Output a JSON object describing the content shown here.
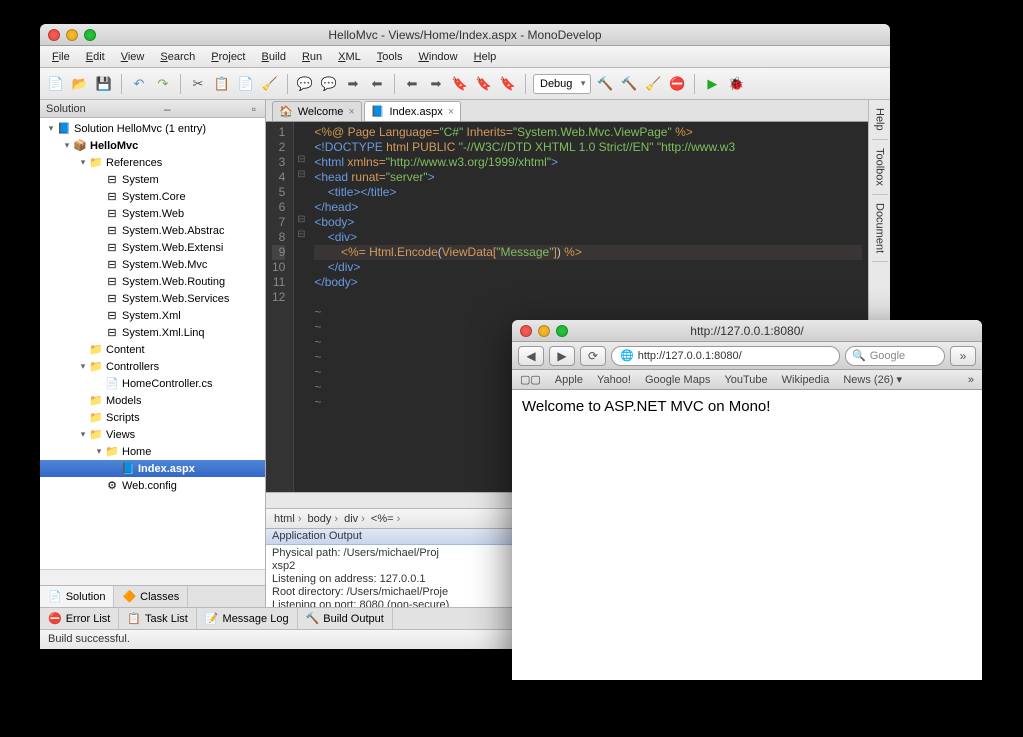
{
  "ide": {
    "title": "HelloMvc - Views/Home/Index.aspx - MonoDevelop",
    "menus": [
      "File",
      "Edit",
      "View",
      "Search",
      "Project",
      "Build",
      "Run",
      "XML",
      "Tools",
      "Window",
      "Help"
    ],
    "config": "Debug",
    "solution_panel": {
      "title": "Solution",
      "tabs": [
        {
          "icon": "📄",
          "label": "Solution"
        },
        {
          "icon": "🔶",
          "label": "Classes"
        }
      ],
      "tree": [
        {
          "depth": 0,
          "tw": "▾",
          "icon": "📘",
          "label": "Solution HelloMvc (1 entry)"
        },
        {
          "depth": 1,
          "tw": "▾",
          "icon": "📦",
          "label": "HelloMvc",
          "bold": true
        },
        {
          "depth": 2,
          "tw": "▾",
          "icon": "📁",
          "label": "References"
        },
        {
          "depth": 3,
          "tw": "",
          "icon": "⊟",
          "label": "System"
        },
        {
          "depth": 3,
          "tw": "",
          "icon": "⊟",
          "label": "System.Core"
        },
        {
          "depth": 3,
          "tw": "",
          "icon": "⊟",
          "label": "System.Web"
        },
        {
          "depth": 3,
          "tw": "",
          "icon": "⊟",
          "label": "System.Web.Abstrac"
        },
        {
          "depth": 3,
          "tw": "",
          "icon": "⊟",
          "label": "System.Web.Extensi"
        },
        {
          "depth": 3,
          "tw": "",
          "icon": "⊟",
          "label": "System.Web.Mvc"
        },
        {
          "depth": 3,
          "tw": "",
          "icon": "⊟",
          "label": "System.Web.Routing"
        },
        {
          "depth": 3,
          "tw": "",
          "icon": "⊟",
          "label": "System.Web.Services"
        },
        {
          "depth": 3,
          "tw": "",
          "icon": "⊟",
          "label": "System.Xml"
        },
        {
          "depth": 3,
          "tw": "",
          "icon": "⊟",
          "label": "System.Xml.Linq"
        },
        {
          "depth": 2,
          "tw": "",
          "icon": "📁",
          "label": "Content"
        },
        {
          "depth": 2,
          "tw": "▾",
          "icon": "📁",
          "label": "Controllers"
        },
        {
          "depth": 3,
          "tw": "",
          "icon": "📄",
          "label": "HomeController.cs"
        },
        {
          "depth": 2,
          "tw": "",
          "icon": "📁",
          "label": "Models"
        },
        {
          "depth": 2,
          "tw": "",
          "icon": "📁",
          "label": "Scripts"
        },
        {
          "depth": 2,
          "tw": "▾",
          "icon": "📁",
          "label": "Views"
        },
        {
          "depth": 3,
          "tw": "▾",
          "icon": "📁",
          "label": "Home"
        },
        {
          "depth": 4,
          "tw": "",
          "icon": "📘",
          "label": "Index.aspx",
          "bold": true,
          "sel": true
        },
        {
          "depth": 3,
          "tw": "",
          "icon": "⚙",
          "label": "Web.config"
        }
      ]
    },
    "doctabs": [
      {
        "icon": "🏠",
        "label": "Welcome"
      },
      {
        "icon": "📘",
        "label": "Index.aspx",
        "active": true
      }
    ],
    "code_lines": [
      {
        "n": 1,
        "fold": "",
        "html": "<span class='c-dir'>&lt;%@</span> <span class='c-attr'>Page</span> <span class='c-attr'>Language=</span><span class='c-str'>\"C#\"</span> <span class='c-attr'>Inherits=</span><span class='c-str'>\"System.Web.Mvc.ViewPage\"</span> <span class='c-dir'>%&gt;</span>"
      },
      {
        "n": 2,
        "fold": "",
        "html": "<span class='c-tag'>&lt;!DOCTYPE</span> <span class='c-attr'>html PUBLIC</span> <span class='c-str'>\"-//W3C//DTD XHTML 1.0 Strict//EN\" \"http://www.w3</span>"
      },
      {
        "n": 3,
        "fold": "⊟",
        "html": "<span class='c-tag'>&lt;html</span> <span class='c-attr'>xmlns=</span><span class='c-str'>\"http://www.w3.org/1999/xhtml\"</span><span class='c-tag'>&gt;</span>"
      },
      {
        "n": 4,
        "fold": "⊟",
        "html": "<span class='c-tag'>&lt;head</span> <span class='c-attr'>runat=</span><span class='c-str'>\"server\"</span><span class='c-tag'>&gt;</span>"
      },
      {
        "n": 5,
        "fold": "",
        "html": "    <span class='c-tag'>&lt;title&gt;&lt;/title&gt;</span>"
      },
      {
        "n": 6,
        "fold": "",
        "html": "<span class='c-tag'>&lt;/head&gt;</span>"
      },
      {
        "n": 7,
        "fold": "⊟",
        "html": "<span class='c-tag'>&lt;body&gt;</span>"
      },
      {
        "n": 8,
        "fold": "⊟",
        "html": "    <span class='c-tag'>&lt;div&gt;</span>"
      },
      {
        "n": 9,
        "fold": "",
        "cur": true,
        "html": "        <span class='c-dir'>&lt;%=</span> <span class='c-attr'>Html.Encode</span><span class='c-text'>(</span><span class='c-attr'>ViewData[</span><span class='c-str'>\"Message\"</span><span class='c-attr'>]</span><span class='c-text'>)</span> <span class='c-dir'>%&gt;</span>"
      },
      {
        "n": 10,
        "fold": "",
        "html": "    <span class='c-tag'>&lt;/div&gt;</span>"
      },
      {
        "n": 11,
        "fold": "",
        "html": "<span class='c-tag'>&lt;/body&gt;</span>"
      },
      {
        "n": 12,
        "fold": "",
        "html": ""
      },
      {
        "n": "",
        "fold": "",
        "html": "<span class='c-comment'>~</span>"
      },
      {
        "n": "",
        "fold": "",
        "html": "<span class='c-comment'>~</span>"
      },
      {
        "n": "",
        "fold": "",
        "html": "<span class='c-comment'>~</span>"
      },
      {
        "n": "",
        "fold": "",
        "html": "<span class='c-comment'>~</span>"
      },
      {
        "n": "",
        "fold": "",
        "html": "<span class='c-comment'>~</span>"
      },
      {
        "n": "",
        "fold": "",
        "html": "<span class='c-comment'>~</span>"
      },
      {
        "n": "",
        "fold": "",
        "html": "<span class='c-comment'>~</span>"
      }
    ],
    "breadcrumb": [
      "html",
      "body",
      "div",
      "<%="
    ],
    "output": {
      "title": "Application Output",
      "lines": [
        "Physical path: /Users/michael/Proj",
        "xsp2",
        "Listening on address: 127.0.0.1",
        "Root directory: /Users/michael/Proje",
        "Listening on port: 8080 (non-secure)"
      ]
    },
    "bottom_tabs": [
      {
        "icon": "⛔",
        "label": "Error List"
      },
      {
        "icon": "📋",
        "label": "Task List"
      },
      {
        "icon": "📝",
        "label": "Message Log"
      },
      {
        "icon": "🔨",
        "label": "Build Output"
      }
    ],
    "status": "Build successful.",
    "right_tabs": [
      "Help",
      "Toolbox",
      "Document"
    ]
  },
  "browser": {
    "title": "http://127.0.0.1:8080/",
    "url": "http://127.0.0.1:8080/",
    "search_placeholder": "Google",
    "bookmarks": [
      "Apple",
      "Yahoo!",
      "Google Maps",
      "YouTube",
      "Wikipedia",
      "News (26) ▾"
    ],
    "page_text": "Welcome to ASP.NET MVC on Mono!"
  }
}
